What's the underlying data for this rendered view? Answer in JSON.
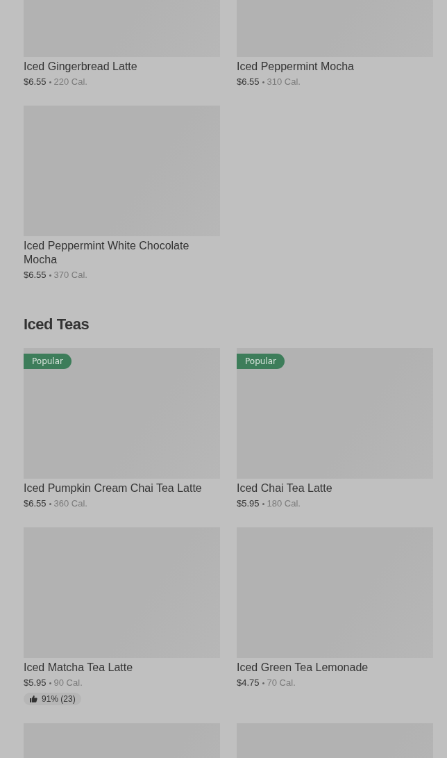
{
  "sections": [
    {
      "items": [
        {
          "image": {
            "kind": "placeholder"
          },
          "name": "Iced Gingerbread Latte",
          "price": "$6.55",
          "calories": "220 Cal."
        },
        {
          "image": {
            "kind": "placeholder"
          },
          "name": "Iced Peppermint Mocha",
          "price": "$6.55",
          "calories": "310 Cal."
        },
        {
          "image": {
            "kind": "placeholder"
          },
          "name": "Iced Peppermint White Chocolate Mocha",
          "price": "$6.55",
          "calories": "370 Cal."
        }
      ]
    },
    {
      "title": "Iced Teas",
      "items": [
        {
          "image": {
            "kind": "placeholder"
          },
          "badge": "Popular",
          "name": "Iced Pumpkin Cream Chai Tea Latte",
          "price": "$6.55",
          "calories": "360 Cal."
        },
        {
          "image": {
            "kind": "placeholder"
          },
          "badge": "Popular",
          "name": "Iced Chai Tea Latte",
          "price": "$5.95",
          "calories": "180 Cal."
        },
        {
          "image": {
            "kind": "placeholder"
          },
          "name": "Iced Matcha Tea Latte",
          "price": "$5.95",
          "calories": "90 Cal.",
          "rating": "91% (23)"
        },
        {
          "image": {
            "kind": "placeholder"
          },
          "name": "Iced Green Tea Lemonade",
          "price": "$4.75",
          "calories": "70 Cal."
        },
        {
          "image": {
            "kind": "placeholder"
          }
        },
        {
          "image": {
            "kind": "placeholder"
          }
        }
      ]
    }
  ]
}
